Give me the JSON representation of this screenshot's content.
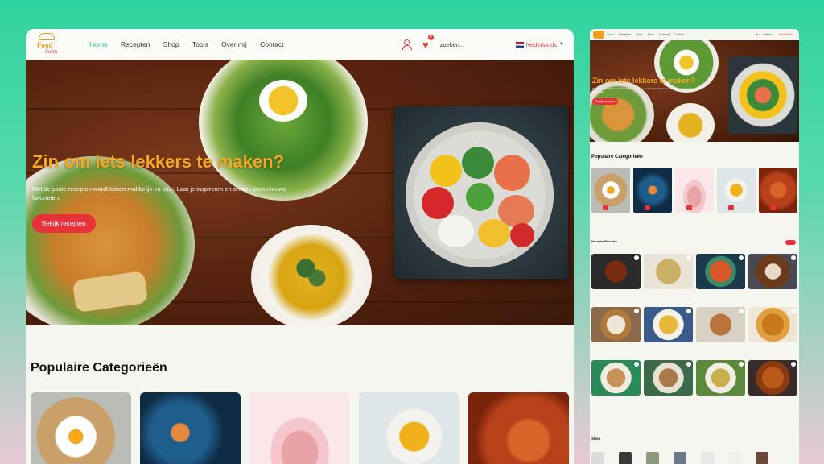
{
  "nav": {
    "items": [
      {
        "label": "Home",
        "active": true
      },
      {
        "label": "Recepten",
        "active": false
      },
      {
        "label": "Shop",
        "active": false
      },
      {
        "label": "Tools",
        "active": false
      },
      {
        "label": "Over mij",
        "active": false
      },
      {
        "label": "Contact",
        "active": false
      }
    ],
    "favorites_count": "0",
    "search_placeholder": "zoeken...",
    "language": "Nederlands"
  },
  "logo": {
    "line1": "Food",
    "line2": "Swan"
  },
  "hero": {
    "title": "Zin om iets lekkers te maken?",
    "subtitle": "Met de juiste recepten wordt koken makkelijk en leuk. Laat je inspireren en ontdek jouw nieuwe favorieten.",
    "button": "Bekijk recepten"
  },
  "categories": {
    "title": "Populaire Categorieën"
  },
  "mobile": {
    "categories_title": "Populaire Categorieën",
    "newest_title": "Nieuwste Recepten",
    "shop_title": "Shop"
  },
  "colors": {
    "accent": "#e8323b",
    "heading_orange": "#f5a623",
    "active_nav": "#22b07a"
  }
}
